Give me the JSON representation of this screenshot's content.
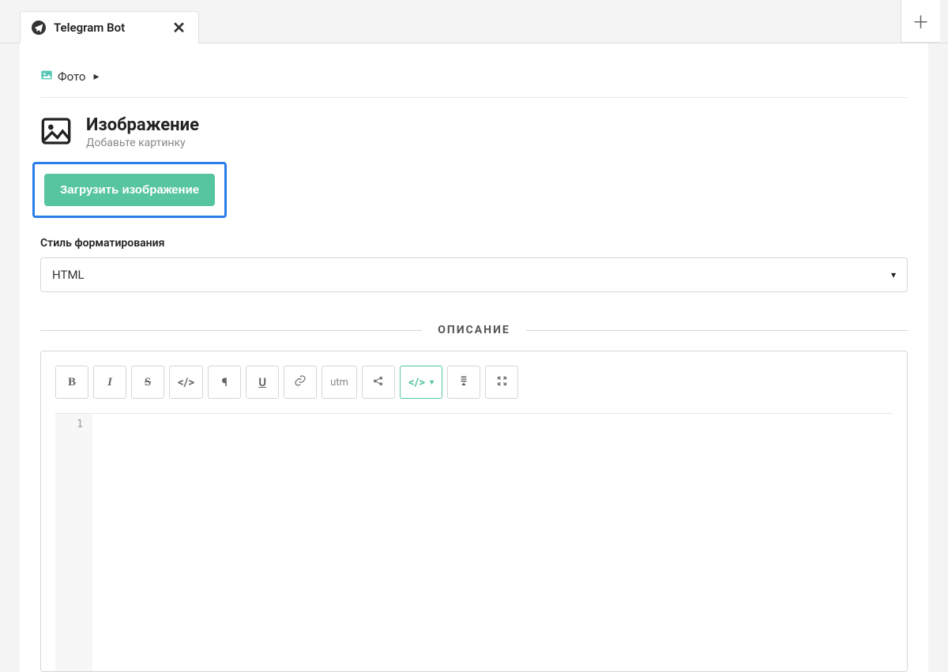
{
  "tab": {
    "title": "Telegram Bot"
  },
  "breadcrumb": {
    "label": "Фото"
  },
  "section": {
    "title": "Изображение",
    "subtitle": "Добавьте картинку",
    "upload_label": "Загрузить изображение"
  },
  "format": {
    "label": "Стиль форматирования",
    "value": "HTML"
  },
  "description": {
    "heading": "ОПИСАНИЕ",
    "toolbar": {
      "utm_label": "utm"
    },
    "line_number": "1"
  }
}
